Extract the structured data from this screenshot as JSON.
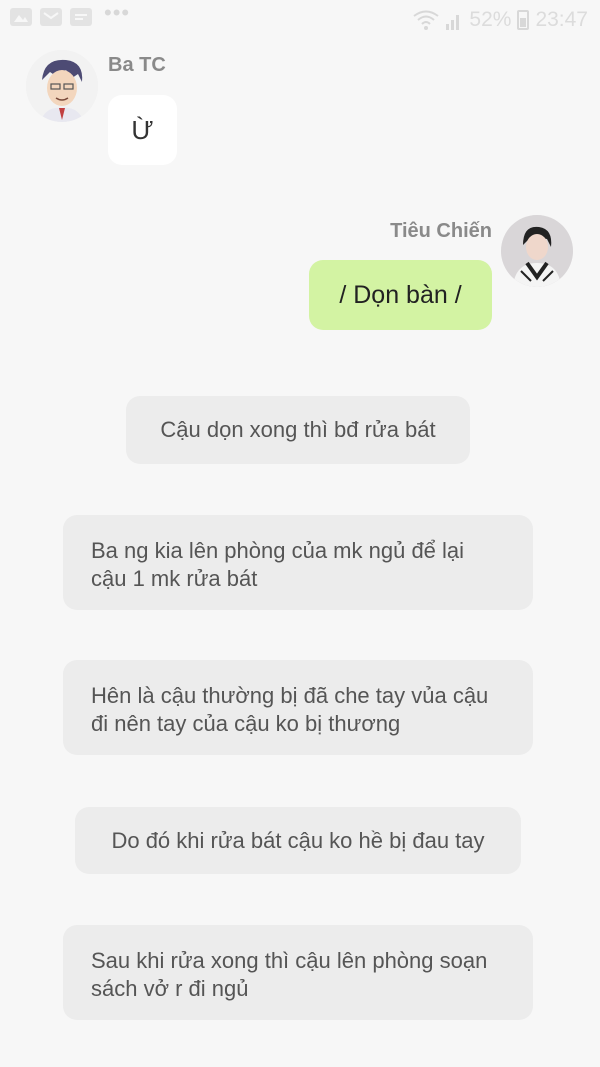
{
  "status_bar": {
    "battery": "52%",
    "time": "23:47",
    "icons": [
      "image-icon",
      "mail-icon",
      "chat-icon",
      "more-dots-icon",
      "wifi-icon",
      "signal-icon",
      "battery-icon"
    ]
  },
  "messages": [
    {
      "sender": "Ba TC",
      "text": "Ừ",
      "side": "left"
    },
    {
      "sender": "Tiêu Chiến",
      "text": "/ Dọn bàn /",
      "side": "right"
    }
  ],
  "narration": [
    "Cậu dọn xong thì bđ rửa bát",
    "Ba ng kia lên phòng của mk ngủ để lại cậu 1 mk rửa bát",
    "Hên là cậu thường bị đã che tay vủa cậu đi nên tay của cậu ko bị thương",
    "Do đó khi rửa bát cậu ko hề bị đau tay",
    "Sau khi rửa xong thì cậu lên phòng soạn sách vở r đi ngủ"
  ],
  "colors": {
    "background": "#f7f7f7",
    "my_bubble": "#d3f3a3",
    "their_bubble": "#ffffff",
    "narration_bubble": "#ececec"
  }
}
